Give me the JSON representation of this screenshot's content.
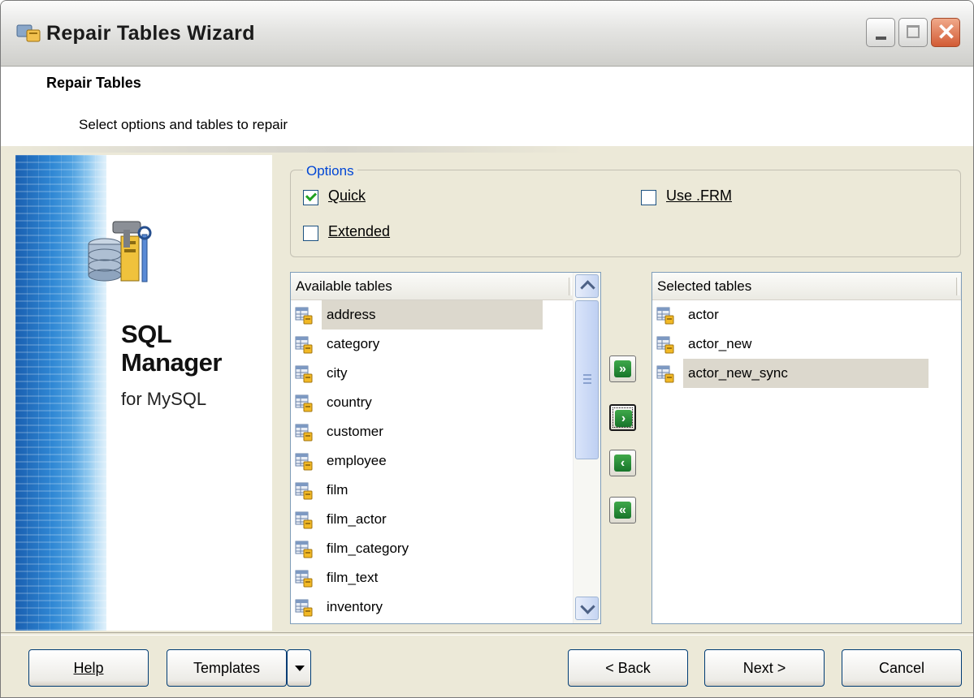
{
  "window": {
    "title": "Repair Tables Wizard",
    "controls": [
      "minimize-icon",
      "maximize-icon",
      "close-icon"
    ]
  },
  "header": {
    "title": "Repair Tables",
    "subtitle": "Select options and tables to repair"
  },
  "banner": {
    "line1": "SQL",
    "line2": "Manager",
    "line3": "for MySQL",
    "icon": "database-tools-icon"
  },
  "options": {
    "legend": "Options",
    "quick": {
      "label": "Quick",
      "checked": true
    },
    "extended": {
      "label": "Extended",
      "checked": false
    },
    "use_frm": {
      "label": "Use .FRM",
      "checked": false
    }
  },
  "available": {
    "header": "Available tables",
    "items": [
      "address",
      "category",
      "city",
      "country",
      "customer",
      "employee",
      "film",
      "film_actor",
      "film_category",
      "film_text",
      "inventory"
    ],
    "selected_index": 0
  },
  "selected": {
    "header": "Selected tables",
    "items": [
      "actor",
      "actor_new",
      "actor_new_sync"
    ],
    "selected_index": 2
  },
  "move_buttons": [
    {
      "name": "move-all-right-button",
      "glyph": "»"
    },
    {
      "name": "move-right-button",
      "glyph": "›"
    },
    {
      "name": "move-left-button",
      "glyph": "‹"
    },
    {
      "name": "move-all-left-button",
      "glyph": "«"
    }
  ],
  "footer": {
    "help": "Help",
    "templates": "Templates",
    "back": "< Back",
    "next": "Next >",
    "cancel": "Cancel"
  },
  "colors": {
    "accent": "#0046d5",
    "selection": "#dcd8cd",
    "dialog_bg": "#ece9d8"
  }
}
